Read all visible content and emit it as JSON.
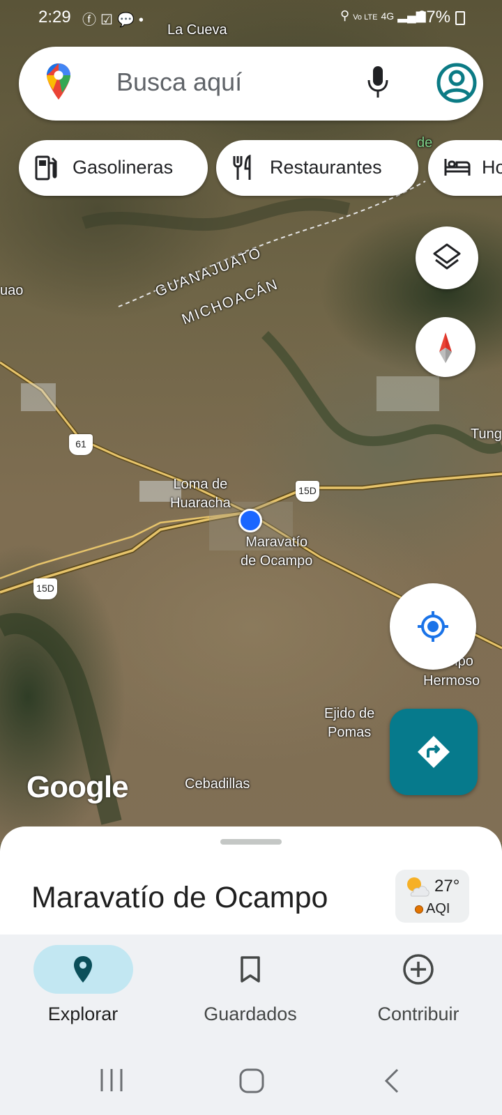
{
  "status_bar": {
    "time": "2:29",
    "battery": "67%",
    "network": "4G",
    "volte": "Vo LTE",
    "left_icons": [
      "facebook-icon",
      "check-icon",
      "chat-icon",
      "dot-icon"
    ],
    "right_icons": [
      "location-icon",
      "signal-icon",
      "battery-icon"
    ]
  },
  "search": {
    "placeholder": "Busca aquí",
    "icons": [
      "maps-logo-icon",
      "mic-icon",
      "profile-icon"
    ]
  },
  "chips": [
    {
      "label": "Gasolineras",
      "icon": "gas-station-icon"
    },
    {
      "label": "Restaurantes",
      "icon": "restaurant-icon"
    },
    {
      "label": "Ho",
      "icon": "hotel-icon"
    }
  ],
  "map": {
    "places": {
      "la_cueva": "La Cueva",
      "uao": "uao",
      "loma_line1": "Loma de",
      "loma_line2": "Huaracha",
      "maravatio_line1": "Maravatío",
      "maravatio_line2": "de Ocampo",
      "tung": "Tung",
      "mpo": "mpo",
      "hermoso": "Hermoso",
      "ejido_line1": "Ejido de",
      "ejido_line2": "Pomas",
      "cebadillas": "Cebadillas",
      "de": "de"
    },
    "states": {
      "north": "GUANAJUATO",
      "south": "MICHOACÁN"
    },
    "shields": [
      "61",
      "15D",
      "15D"
    ],
    "attribution": "Google",
    "controls": [
      "layers-icon",
      "compass-icon",
      "my-location-icon",
      "directions-icon"
    ],
    "colors": {
      "location_dot": "#1a66ff",
      "directions_fab": "#067a8c"
    }
  },
  "sheet": {
    "title": "Maravatío de Ocampo",
    "weather": {
      "temp": "27°",
      "aqi_label": "AQI",
      "icon": "partly-cloudy-icon"
    }
  },
  "bottom_nav": {
    "items": [
      {
        "label": "Explorar",
        "icon": "explore-pin-icon",
        "active": true
      },
      {
        "label": "Guardados",
        "icon": "bookmark-icon",
        "active": false
      },
      {
        "label": "Contribuir",
        "icon": "add-circle-icon",
        "active": false
      }
    ],
    "active_color": "#c2e7f2"
  },
  "system_nav": [
    "recents-icon",
    "home-icon",
    "back-icon"
  ]
}
